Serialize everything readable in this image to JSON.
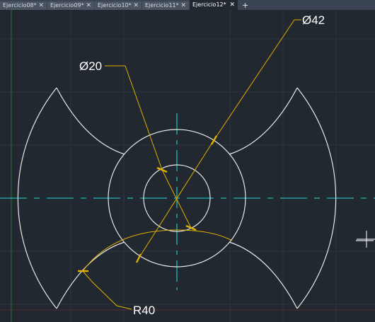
{
  "tabs": [
    {
      "label": "Ejercicio08*",
      "close": "✕"
    },
    {
      "label": "Ejercicio09*",
      "close": "✕"
    },
    {
      "label": "Ejercicio10*",
      "close": "✕"
    },
    {
      "label": "Ejercicio11*",
      "close": "✕"
    },
    {
      "label": "Ejercicio12*",
      "close": "✕",
      "active": true
    }
  ],
  "new_tab": "+",
  "dimensions": {
    "dia_large": "Ø42",
    "dia_small": "Ø20",
    "radius": "R40"
  },
  "colors": {
    "background": "#212830",
    "geometry": "#e8e8e8",
    "centerline": "#20b8b8",
    "dimension": "#e0b000",
    "grid": "#2c3540"
  }
}
